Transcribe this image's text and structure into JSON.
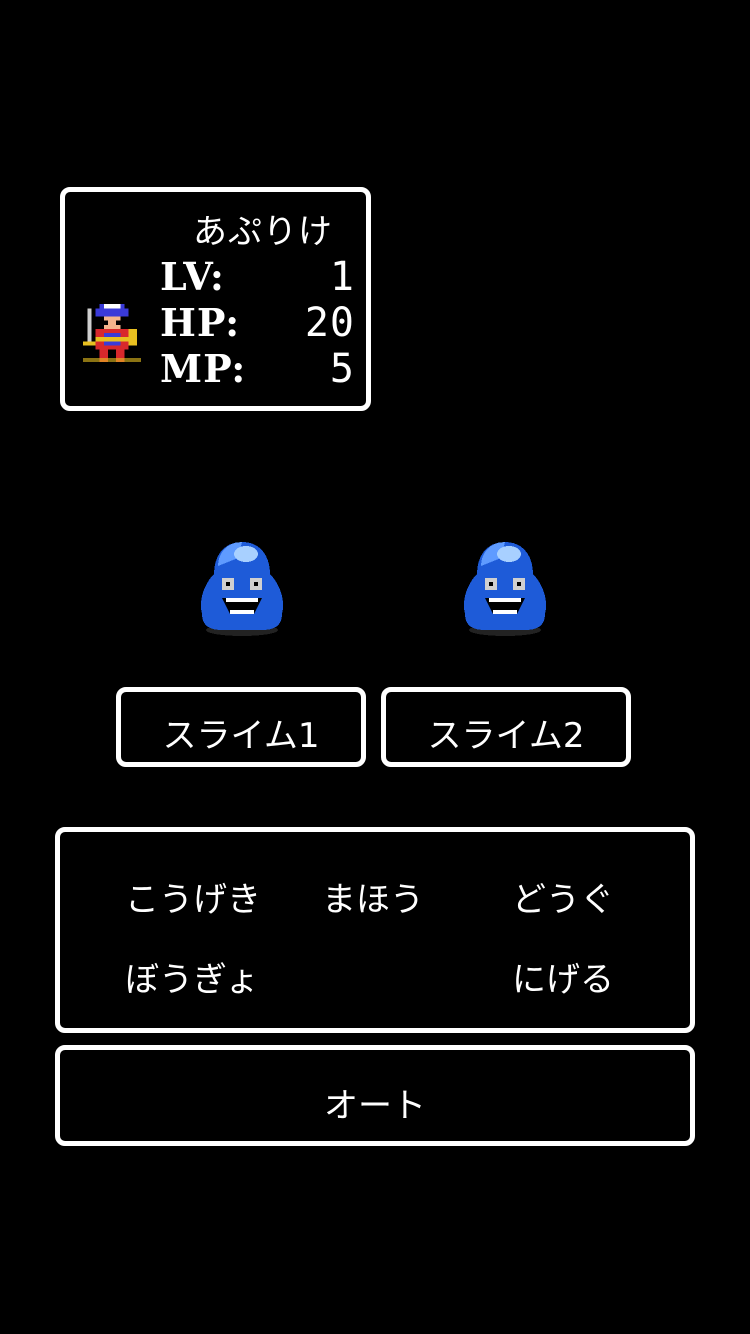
{
  "status": {
    "hero_name": "あぷりけ",
    "lv_label": "LV:",
    "lv_value": "1",
    "hp_label": "HP:",
    "hp_value": "20",
    "mp_label": "MP:",
    "mp_value": "5",
    "hero_icon": "hero-sprite-icon"
  },
  "enemies": [
    {
      "name": "スライム1",
      "icon": "blue-slime-icon"
    },
    {
      "name": "スライム2",
      "icon": "blue-slime-icon"
    }
  ],
  "commands": {
    "attack": "こうげき",
    "magic": "まほう",
    "item": "どうぐ",
    "defend": "ぼうぎょ",
    "flee": "にげる"
  },
  "auto_label": "オート",
  "colors": {
    "background": "#000000",
    "frame": "#ffffff",
    "slime": "#1e5bd8"
  }
}
